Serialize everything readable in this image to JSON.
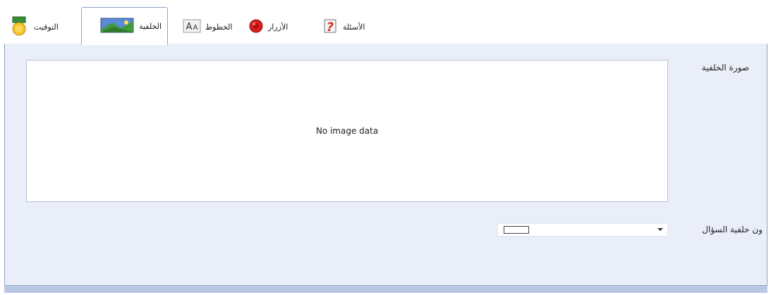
{
  "tabs": [
    {
      "label": "الأسئلة",
      "icon": "question-mark-icon"
    },
    {
      "label": "الأزرار",
      "icon": "red-button-icon"
    },
    {
      "label": "الخطوط",
      "icon": "font-icon"
    },
    {
      "label": "الخلفية",
      "icon": "picture-icon",
      "active": true
    },
    {
      "label": "التوقيت",
      "icon": "timer-medal-icon"
    }
  ],
  "background_image": {
    "label": "صورة الخلفية",
    "placeholder_text": "No image data"
  },
  "question_background": {
    "label": "ون خلفية السؤال",
    "selected_color": "#ffffff"
  },
  "colors": {
    "panel_bg": "#e9eef8",
    "border": "#8da2c4",
    "accent_bar": "#b8c8e3"
  }
}
